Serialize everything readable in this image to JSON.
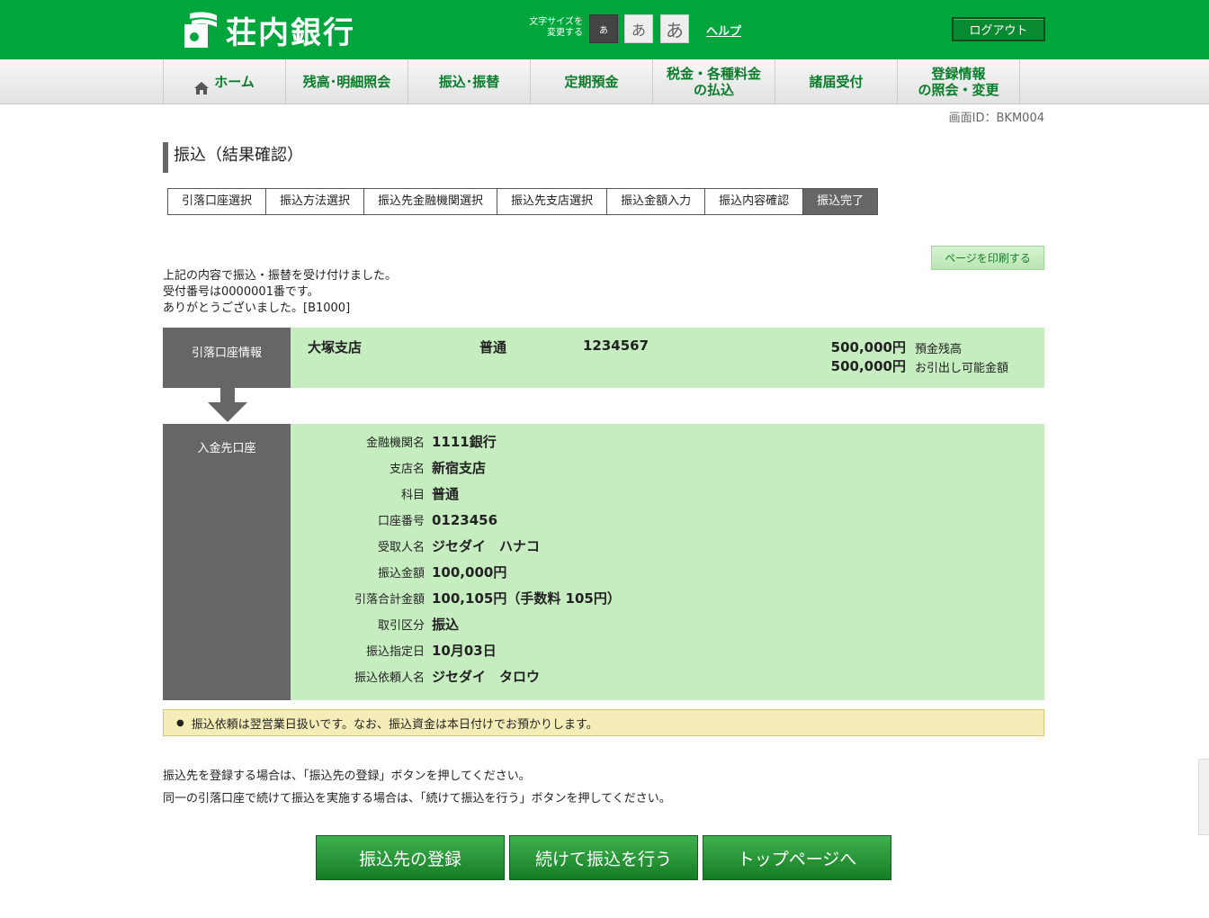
{
  "header": {
    "bank_name": "荘内銀行",
    "font_size_label": "文字サイズを\n変更する",
    "font_size_small": "あ",
    "font_size_medium": "あ",
    "font_size_large": "あ",
    "help": "ヘルプ",
    "logout": "ログアウト"
  },
  "nav": {
    "items": [
      {
        "label": "ホーム"
      },
      {
        "label": "残高･明細照会"
      },
      {
        "label": "振込･振替"
      },
      {
        "label": "定期預金"
      },
      {
        "label": "税金・各種料金\nの払込"
      },
      {
        "label": "諸届受付"
      },
      {
        "label": "登録情報\nの照会・変更"
      }
    ]
  },
  "screen_id": "画面ID：BKM004",
  "title": "振込（結果確認）",
  "steps": [
    "引落口座選択",
    "振込方法選択",
    "振込先金融機関選択",
    "振込先支店選択",
    "振込金額入力",
    "振込内容確認",
    "振込完了"
  ],
  "print_button": "ページを印刷する",
  "message": {
    "line1": "上記の内容で振込・振替を受け付けました。",
    "line2": "受付番号は0000001番です。",
    "line3": "ありがとうございました。[B1000]"
  },
  "source": {
    "label": "引落口座情報",
    "branch": "大塚支店",
    "type": "普通",
    "number": "1234567",
    "balance": "500,000円",
    "balance_label": "預金残高",
    "available": "500,000円",
    "available_label": "お引出し可能金額"
  },
  "destination": {
    "label": "入金先口座",
    "rows": [
      {
        "key": "金融機関名",
        "value": "1111銀行"
      },
      {
        "key": "支店名",
        "value": "新宿支店"
      },
      {
        "key": "科目",
        "value": "普通"
      },
      {
        "key": "口座番号",
        "value": "0123456"
      },
      {
        "key": "受取人名",
        "value": "ジセダイ　ハナコ"
      },
      {
        "key": "振込金額",
        "value": "100,000円"
      },
      {
        "key": "引落合計金額",
        "value": "100,105円（手数料 105円）"
      },
      {
        "key": "取引区分",
        "value": "振込"
      },
      {
        "key": "振込指定日",
        "value": "10月03日"
      },
      {
        "key": "振込依頼人名",
        "value": "ジセダイ　タロウ"
      }
    ]
  },
  "notice": "振込依頼は翌営業日扱いです。なお、振込資金は本日付けでお預かりします。",
  "info": {
    "line1": "振込先を登録する場合は、「振込先の登録」ボタンを押してください。",
    "line2": "同一の引落口座で続けて振込を実施する場合は、「続けて振込を行う」ボタンを押してください。"
  },
  "buttons": {
    "register": "振込先の登録",
    "continue": "続けて振込を行う",
    "top": "トップページへ"
  },
  "colors": {
    "header_green": "#00a63c",
    "panel_green": "#c6edc0",
    "label_gray": "#666666",
    "notice_yellow": "#f5edb8"
  }
}
